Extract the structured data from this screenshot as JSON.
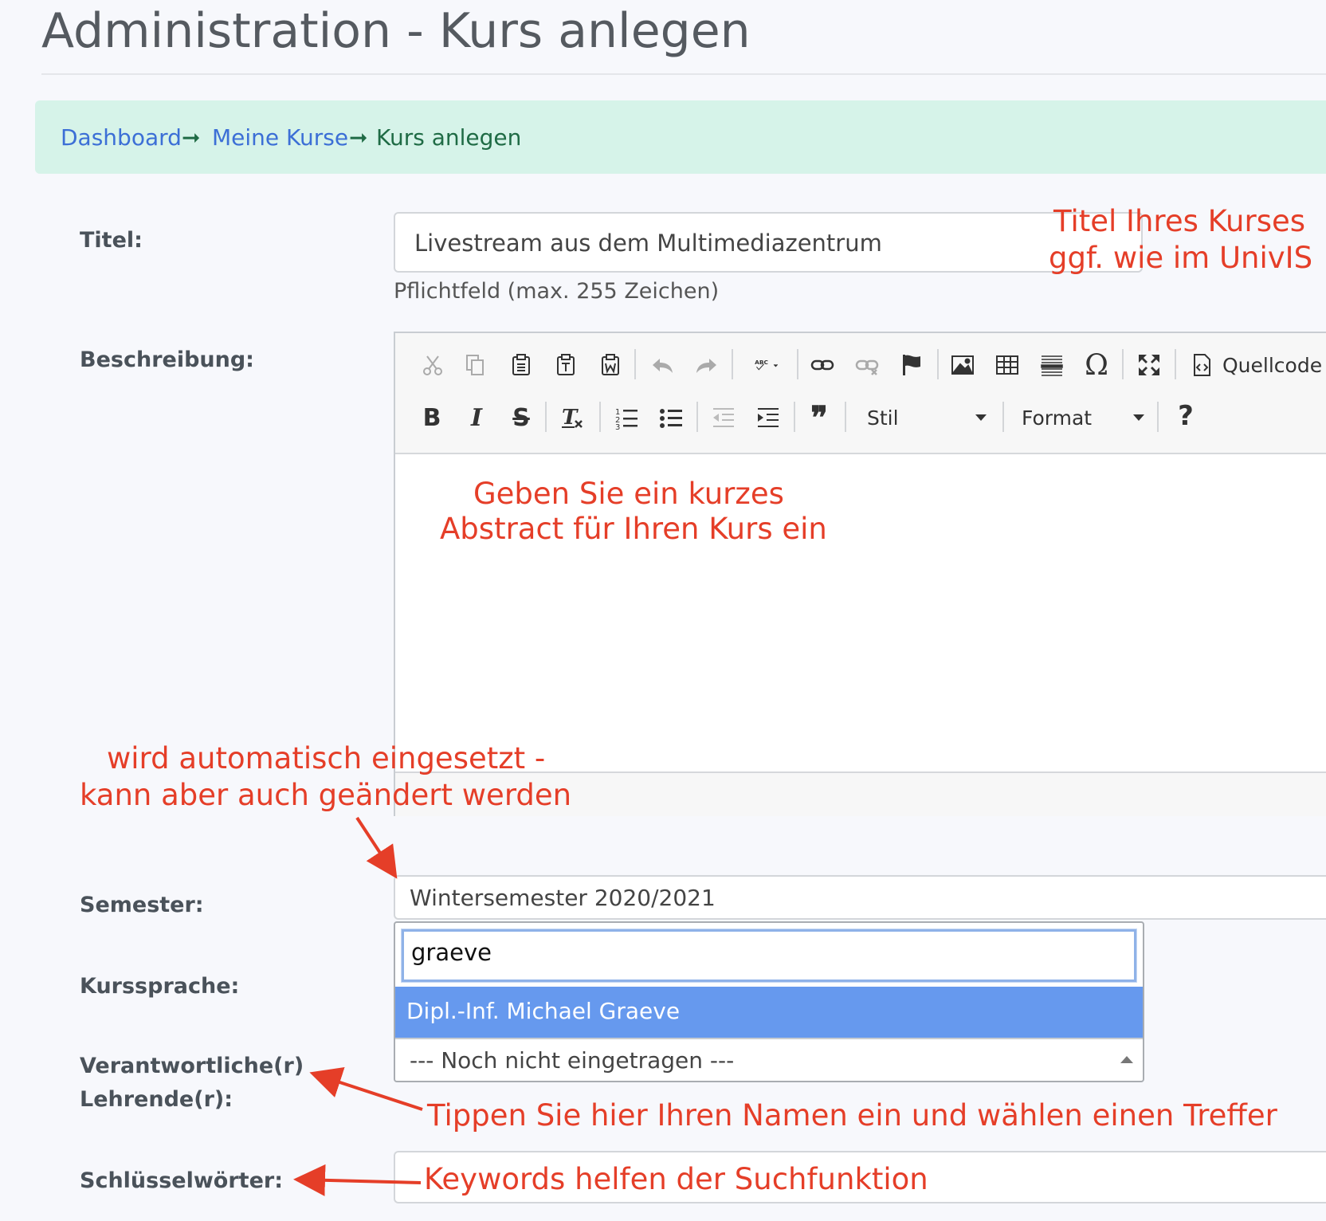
{
  "page": {
    "title": "Administration - Kurs anlegen"
  },
  "breadcrumb": {
    "items": [
      {
        "label": "Dashboard",
        "link": true
      },
      {
        "label": "Meine Kurse",
        "link": true
      },
      {
        "label": "Kurs anlegen",
        "link": false
      }
    ],
    "separator": "➞"
  },
  "form": {
    "titel": {
      "label": "Titel:",
      "value": "Livestream aus dem Multimediazentrum",
      "hint": "Pflichtfeld (max. 255 Zeichen)"
    },
    "beschreibung": {
      "label": "Beschreibung:",
      "toolbar": {
        "source_label": "Quellcode",
        "style_label": "Stil",
        "format_label": "Format",
        "help_label": "?"
      }
    },
    "semester": {
      "label": "Semester:",
      "value": "Wintersemester 2020/2021"
    },
    "kurssprache": {
      "label": "Kurssprache:"
    },
    "verantwortliche": {
      "label_line1": "Verantwortliche(r)",
      "label_line2": "Lehrende(r):",
      "search_value": "graeve",
      "highlighted_option": "Dipl.-Inf. Michael Graeve",
      "selected_value": "--- Noch nicht eingetragen ---"
    },
    "schluesselwoerter": {
      "label": "Schlüsselwörter:"
    }
  },
  "annotations": {
    "titel_line1": "Titel Ihres Kurses",
    "titel_line2": "ggf. wie im UnivIS",
    "beschreibung_line1": "Geben Sie ein kurzes",
    "beschreibung_line2": "Abstract für Ihren Kurs ein",
    "semester_line1": "wird automatisch eingesetzt -",
    "semester_line2": "kann aber auch geändert werden",
    "lehrende": "Tippen Sie hier Ihren Namen ein und wählen einen Treffer",
    "keywords": "Keywords helfen der Suchfunktion"
  },
  "colors": {
    "annotation": "#e53e28",
    "breadcrumb_bg": "#d6f3e9",
    "link": "#3c6fd6",
    "highlight": "#6699ee"
  }
}
